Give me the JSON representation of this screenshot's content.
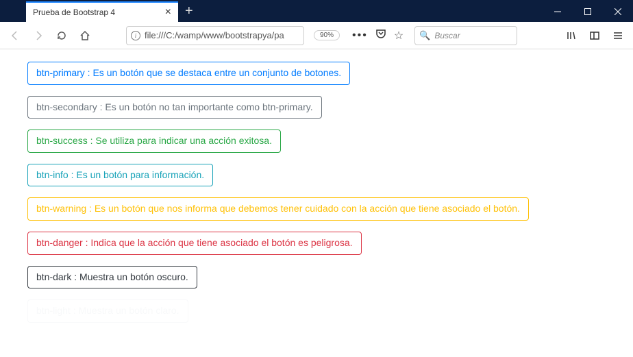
{
  "browser": {
    "tab_title": "Prueba de Bootstrap 4",
    "url": "file:///C:/wamp/www/bootstrapya/pa",
    "zoom": "90%",
    "search_placeholder": "Buscar"
  },
  "buttons": [
    {
      "cls": "primary",
      "text": "btn-primary : Es un botón que se destaca entre un conjunto de botones."
    },
    {
      "cls": "secondary",
      "text": "btn-secondary : Es un botón no tan importante como btn-primary."
    },
    {
      "cls": "success",
      "text": "btn-success : Se utiliza para indicar una acción exitosa."
    },
    {
      "cls": "info",
      "text": "btn-info : Es un botón para información."
    },
    {
      "cls": "warning",
      "text": "btn-warning : Es un botón que nos informa que debemos tener cuidado con la acción que tiene asociado el botón."
    },
    {
      "cls": "danger",
      "text": "btn-danger : Indica que la acción que tiene asociado el botón es peligrosa."
    },
    {
      "cls": "dark",
      "text": "btn-dark : Muestra un botón oscuro."
    },
    {
      "cls": "light",
      "text": "btn-light : Muestra un botón claro."
    }
  ]
}
